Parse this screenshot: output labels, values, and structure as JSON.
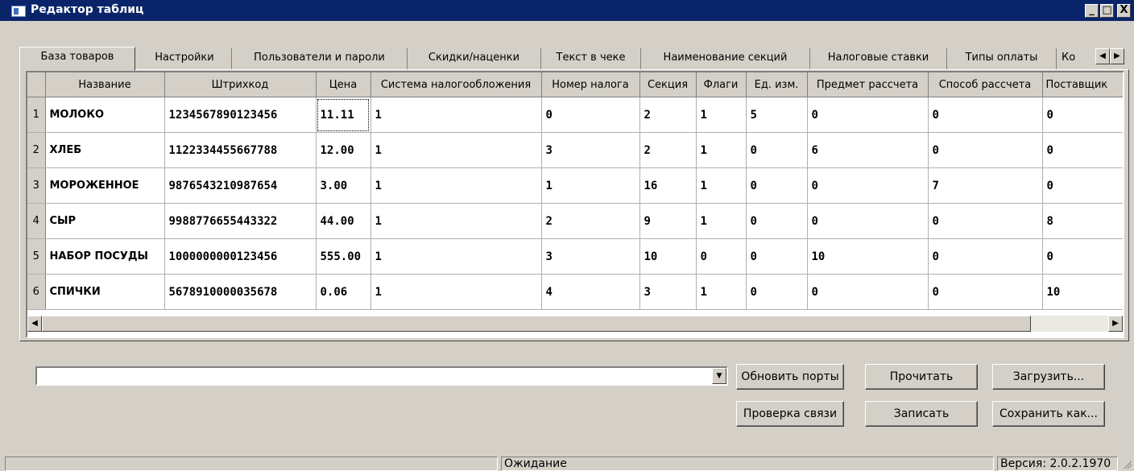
{
  "window": {
    "title": "Редактор таблиц",
    "minimize": "_",
    "maximize": "□",
    "close": "X"
  },
  "tabs": [
    {
      "label": "База товаров",
      "active": true
    },
    {
      "label": "Настройки"
    },
    {
      "label": "Пользователи и пароли"
    },
    {
      "label": "Скидки/наценки"
    },
    {
      "label": "Текст в чеке"
    },
    {
      "label": "Наименование секций"
    },
    {
      "label": "Налоговые ставки"
    },
    {
      "label": "Типы оплаты"
    },
    {
      "label": "Ко"
    }
  ],
  "grid": {
    "columns": [
      "Название",
      "Штрихкод",
      "Цена",
      "Система налогообложения",
      "Номер налога",
      "Секция",
      "Флаги",
      "Ед. изм.",
      "Предмет рассчета",
      "Способ рассчета",
      "Поставщик"
    ],
    "rows": [
      {
        "num": "1",
        "cells": [
          "МОЛОКО",
          "1234567890123456",
          "11.11",
          "1",
          "0",
          "2",
          "1",
          "5",
          "0",
          "0",
          "0"
        ]
      },
      {
        "num": "2",
        "cells": [
          "ХЛЕБ",
          "1122334455667788",
          "12.00",
          "1",
          "3",
          "2",
          "1",
          "0",
          "6",
          "0",
          "0"
        ]
      },
      {
        "num": "3",
        "cells": [
          "МОРОЖЕННОЕ",
          "9876543210987654",
          "3.00",
          "1",
          "1",
          "16",
          "1",
          "0",
          "0",
          "7",
          "0"
        ]
      },
      {
        "num": "4",
        "cells": [
          "СЫР",
          "9988776655443322",
          "44.00",
          "1",
          "2",
          "9",
          "1",
          "0",
          "0",
          "0",
          "8"
        ]
      },
      {
        "num": "5",
        "cells": [
          "НАБОР ПОСУДЫ",
          "1000000000123456",
          "555.00",
          "1",
          "3",
          "10",
          "0",
          "0",
          "10",
          "0",
          "0"
        ]
      },
      {
        "num": "6",
        "cells": [
          "СПИЧКИ",
          "5678910000035678",
          "0.06",
          "1",
          "4",
          "3",
          "1",
          "0",
          "0",
          "0",
          "10"
        ]
      }
    ]
  },
  "port": {
    "value": ""
  },
  "buttons": {
    "refresh_ports": "Обновить порты",
    "read": "Прочитать",
    "load": "Загрузить...",
    "check_connection": "Проверка связи",
    "write": "Записать",
    "save_as": "Сохранить как..."
  },
  "status": {
    "state": "Ожидание",
    "version": "Версия: 2.0.2.1970"
  }
}
